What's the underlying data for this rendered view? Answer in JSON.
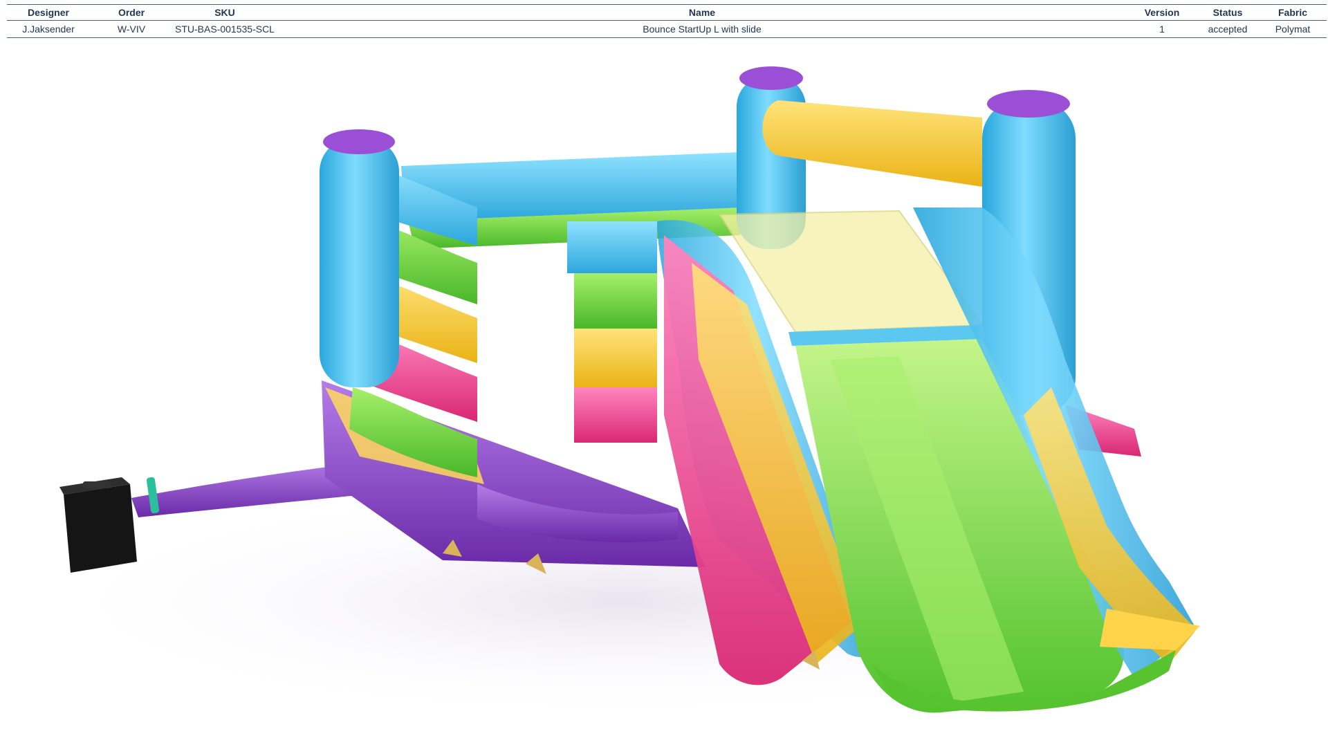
{
  "spec_table": {
    "headers": {
      "designer": "Designer",
      "order": "Order",
      "sku": "SKU",
      "name": "Name",
      "version": "Version",
      "status": "Status",
      "fabric": "Fabric"
    },
    "row": {
      "designer": "J.Jaksender",
      "order": "W-VIV",
      "sku": "STU-BAS-001535-SCL",
      "name": "Bounce StartUp L with slide",
      "version": "1",
      "status": "accepted",
      "fabric": "Polymat"
    }
  },
  "colors": {
    "blue": "#43c2ee",
    "green": "#6fd83a",
    "yellow": "#f7cb2a",
    "pink": "#ee3f8c",
    "purple": "#8a43c6",
    "header_text": "#1f3550",
    "rule": "#45607e"
  }
}
